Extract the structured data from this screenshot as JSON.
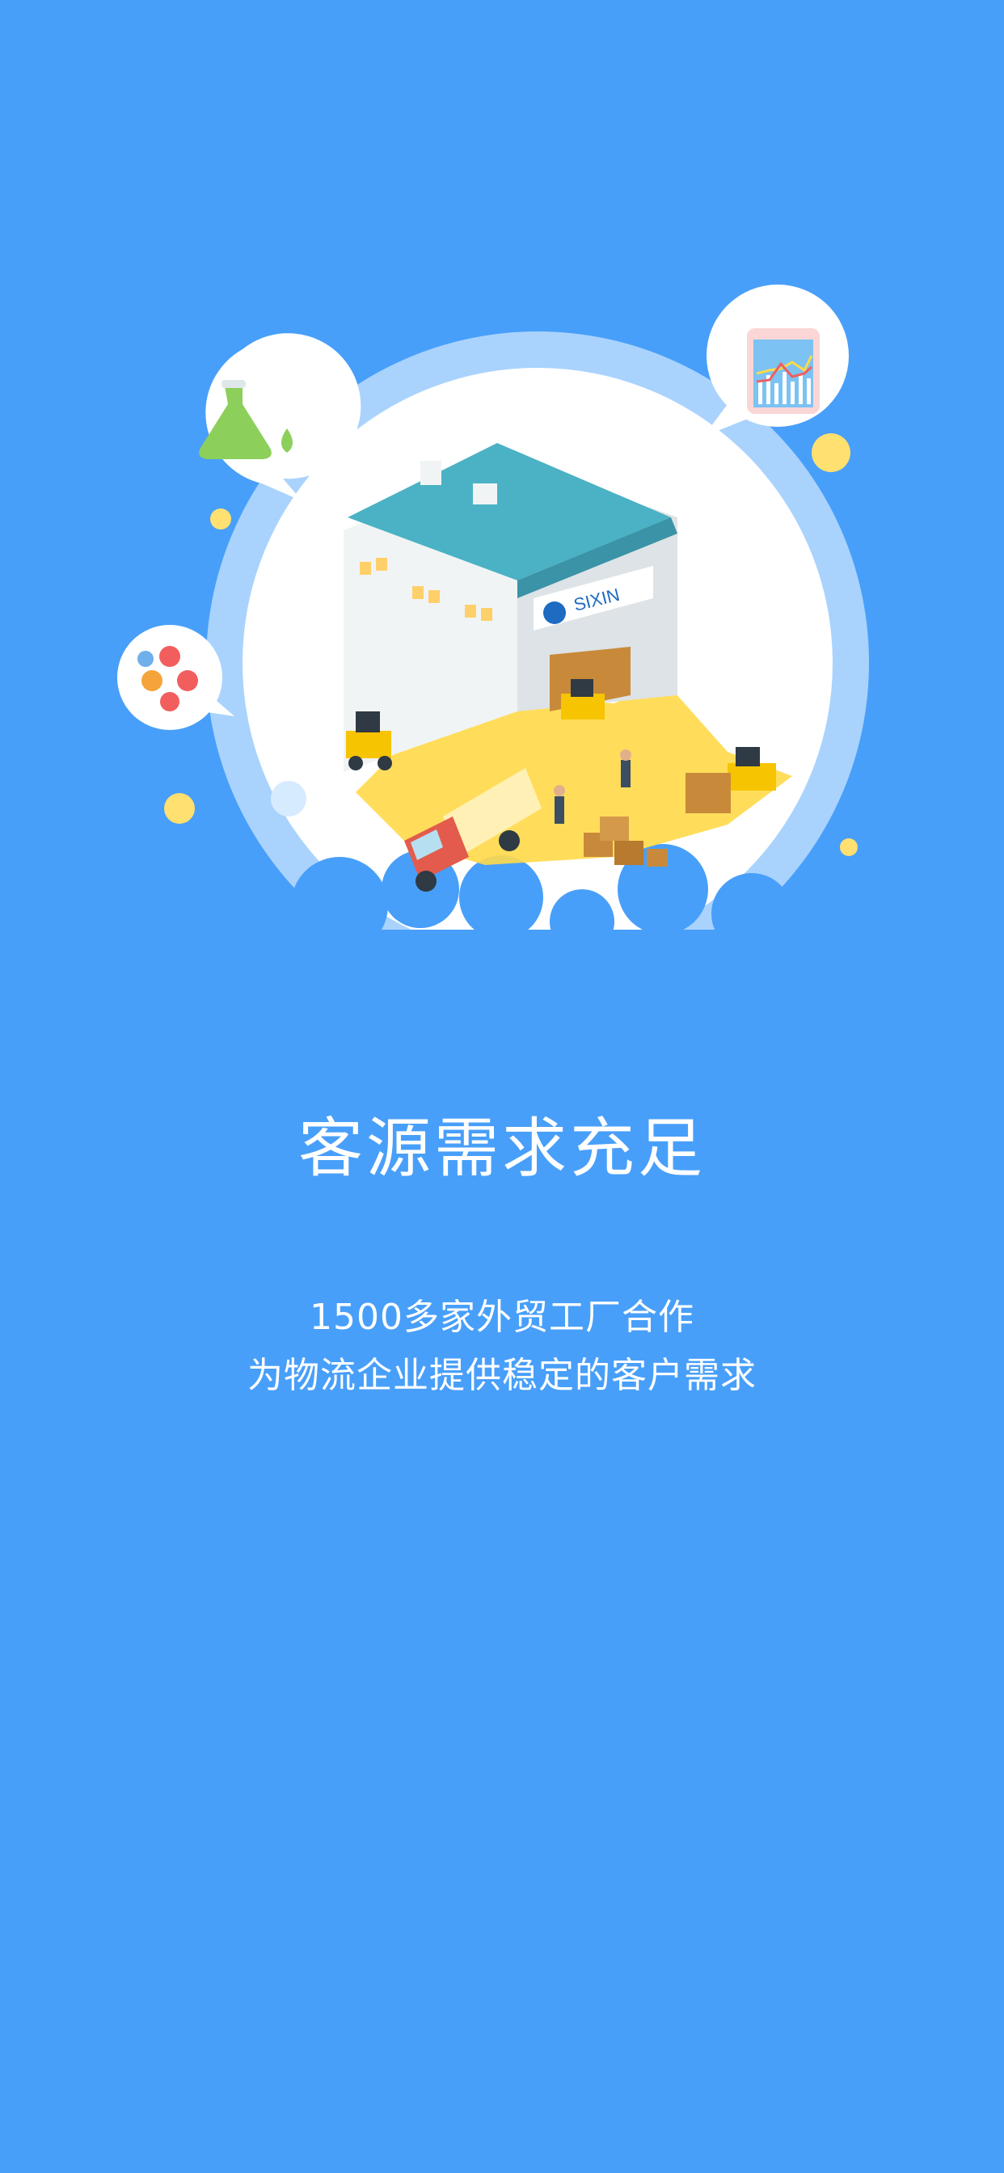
{
  "onboarding": {
    "title": "客源需求充足",
    "description_line1": "1500多家外贸工厂合作",
    "description_line2": "为物流企业提供稳定的客户需求"
  },
  "illustration": {
    "logo_text": "SIXIN",
    "icons": [
      "flask-icon",
      "molecule-icon",
      "chart-phone-icon",
      "warehouse-illustration",
      "forklift-icon",
      "truck-icon",
      "boxes-icon"
    ],
    "colors": {
      "background": "#489ff9",
      "halo": "#a9d3fd",
      "accent_yellow": "#ffd949",
      "roof_teal": "#4ab2c4"
    }
  }
}
